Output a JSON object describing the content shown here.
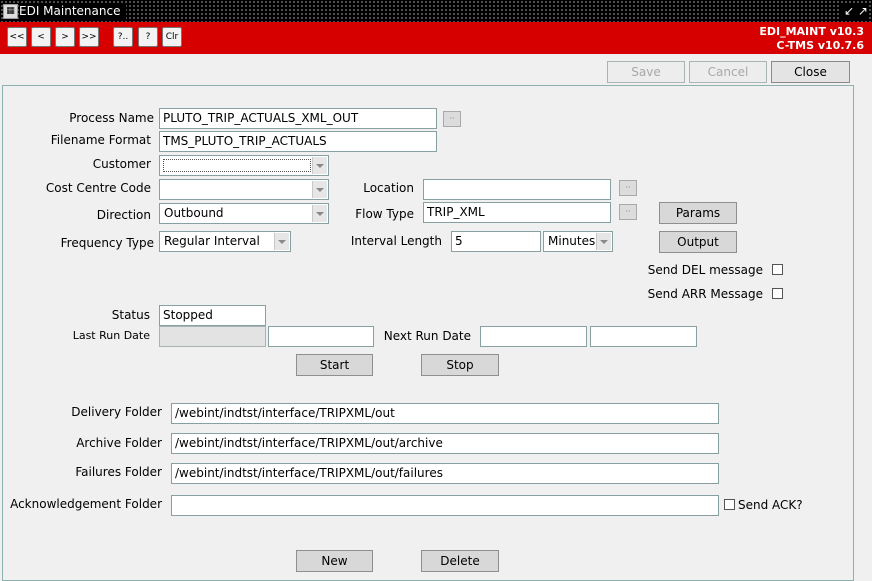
{
  "window": {
    "title": "EDI Maintenance",
    "controls": "↙ ↗"
  },
  "toolbar": {
    "first": "<<",
    "prev": "<",
    "next": ">",
    "last": ">>",
    "query": "?..",
    "help": "?",
    "clear": "Clr",
    "version_line1": "EDI_MAINT v10.3",
    "version_line2": "C-TMS v10.7.6"
  },
  "actions": {
    "save": "Save",
    "cancel": "Cancel",
    "close": "Close"
  },
  "form": {
    "process_name_label": "Process Name",
    "process_name": "PLUTO_TRIP_ACTUALS_XML_OUT",
    "filename_format_label": "Filename Format",
    "filename_format": "TMS_PLUTO_TRIP_ACTUALS",
    "customer_label": "Customer",
    "customer": "",
    "cost_centre_label": "Cost Centre Code",
    "cost_centre": "",
    "location_label": "Location",
    "location": "",
    "direction_label": "Direction",
    "direction": "Outbound",
    "flow_type_label": "Flow Type",
    "flow_type": "TRIP_XML",
    "params_button": "Params",
    "frequency_type_label": "Frequency Type",
    "frequency_type": "Regular Interval",
    "interval_length_label": "Interval Length",
    "interval_length": "5",
    "interval_unit": "Minutes",
    "output_button": "Output",
    "send_del_label": "Send DEL message",
    "send_arr_label": "Send ARR Message",
    "status_label": "Status",
    "status": "Stopped",
    "last_run_label": "Last Run Date",
    "last_run_date": "",
    "last_run_time": "",
    "next_run_label": "Next Run Date",
    "next_run_date": "",
    "next_run_time": "",
    "start_button": "Start",
    "stop_button": "Stop",
    "delivery_folder_label": "Delivery Folder",
    "delivery_folder": "/webint/indtst/interface/TRIPXML/out",
    "archive_folder_label": "Archive Folder",
    "archive_folder": "/webint/indtst/interface/TRIPXML/out/archive",
    "failures_folder_label": "Failures Folder",
    "failures_folder": "/webint/indtst/interface/TRIPXML/out/failures",
    "ack_folder_label": "Acknowledgement Folder",
    "ack_folder": "",
    "send_ack_label": "Send ACK?",
    "new_button": "New",
    "delete_button": "Delete"
  },
  "colors": {
    "toolbar_red": "#d70000",
    "panel_border": "#8eb0b0"
  }
}
